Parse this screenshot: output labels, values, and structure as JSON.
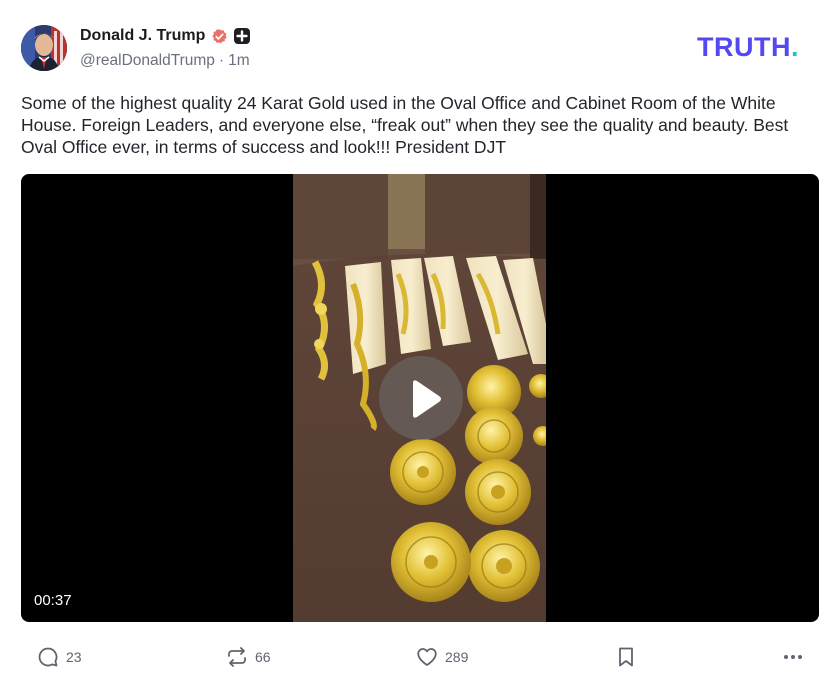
{
  "post": {
    "author": {
      "display_name": "Donald J. Trump",
      "handle": "@realDonaldTrump",
      "separator": "·",
      "time": "1m",
      "verified_badge": "verified-icon",
      "plus_badge": "plus-badge-icon"
    },
    "brand": {
      "logo_text": "TRUTH",
      "logo_dot": ".",
      "color": "#5448ee",
      "dot_color": "#17c9c4"
    },
    "text": "Some of the highest quality 24 Karat Gold used in the Oval Office and Cabinet Room of the White House. Foreign Leaders, and everyone else, “freak out” when they see the quality and beauty. Best Oval Office ever, in terms of success and look!!! President DJT",
    "video": {
      "duration": "00:37",
      "play_icon": "play-icon"
    },
    "actions": {
      "replies": {
        "icon": "comment-icon",
        "count": "23"
      },
      "retruths": {
        "icon": "repost-icon",
        "count": "66"
      },
      "likes": {
        "icon": "heart-icon",
        "count": "289"
      },
      "bookmark": {
        "icon": "bookmark-icon"
      },
      "more": {
        "icon": "more-icon"
      }
    }
  }
}
